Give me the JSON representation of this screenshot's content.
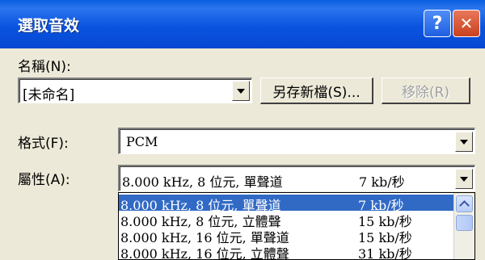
{
  "window": {
    "title": "選取音效",
    "help_label": "?",
    "close_label": "✕"
  },
  "name": {
    "label": "名稱(N):",
    "value": "[未命名]",
    "save_as_label": "另存新檔(S)...",
    "remove_label": "移除(R)"
  },
  "format": {
    "label": "格式(F):",
    "value": "PCM"
  },
  "attributes": {
    "label": "屬性(A):",
    "selected_format": "8.000 kHz, 8 位元, 單聲道",
    "selected_rate": "7 kb/秒",
    "options": [
      {
        "format": "8.000 kHz, 8 位元, 單聲道",
        "rate": "7 kb/秒",
        "selected": true
      },
      {
        "format": "8.000 kHz, 8 位元, 立體聲",
        "rate": "15 kb/秒",
        "selected": false
      },
      {
        "format": "8.000 kHz, 16 位元, 單聲道",
        "rate": "15 kb/秒",
        "selected": false
      },
      {
        "format": "8.000 kHz, 16 位元, 立體聲",
        "rate": "31 kb/秒",
        "selected": false
      }
    ]
  },
  "colors": {
    "titlebar": "#0a54e0",
    "selection": "#316ac5",
    "dialog_bg": "#ece9d8"
  }
}
